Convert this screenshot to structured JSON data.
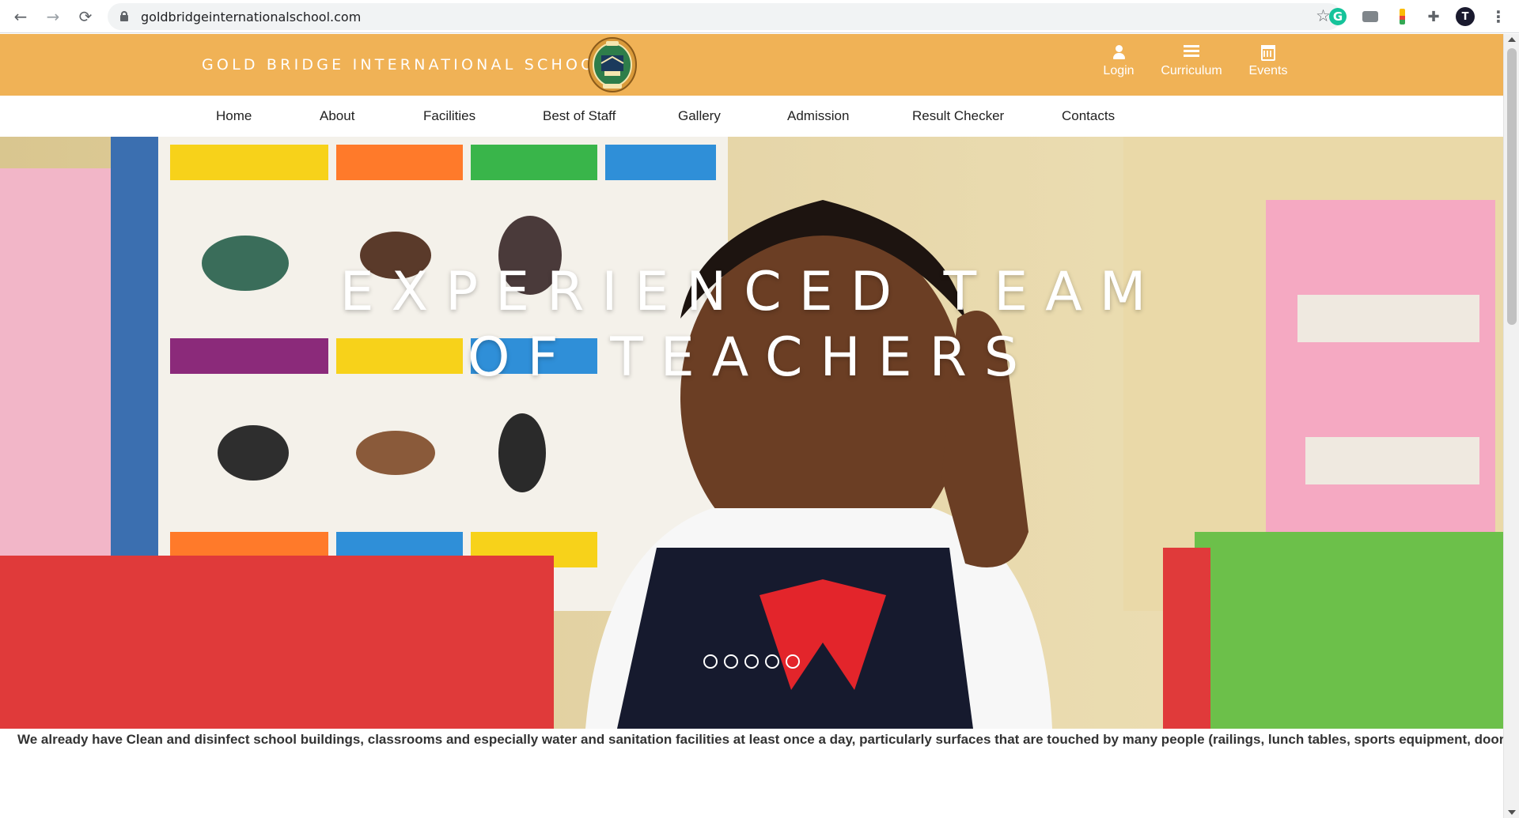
{
  "browser": {
    "url": "goldbridgeinternationalschool.com",
    "back_icon": "←",
    "forward_icon": "→",
    "reload_icon": "⟳",
    "star_icon": "☆",
    "grammarly_letter": "G",
    "puzzle_icon": "✚",
    "avatar_letter": "T",
    "menu_icon": "⋮"
  },
  "header": {
    "brand": "GOLD BRIDGE INTERNATIONAL SCHOOL",
    "links": [
      {
        "label": "Login",
        "icon": "user-icon"
      },
      {
        "label": "Curriculum",
        "icon": "list-icon"
      },
      {
        "label": "Events",
        "icon": "calendar-icon"
      }
    ]
  },
  "nav": {
    "items": [
      "Home",
      "About",
      "Facilities",
      "Best of Staff",
      "Gallery",
      "Admission",
      "Result Checker",
      "Contacts"
    ]
  },
  "hero": {
    "title_line1": "EXPERIENCED TEAM",
    "title_line2": "OF TEACHERS",
    "slide_count": 5
  },
  "ticker": {
    "text": "We already have Clean and disinfect school buildings, classrooms and especially water and sanitation facilities at least once a day, particularly surfaces that are touched by many people (railings, lunch tables, sports equipment, door and window handles, toys, teaching"
  },
  "colors": {
    "header_bg": "#f0b256",
    "nav_text": "#222222"
  }
}
